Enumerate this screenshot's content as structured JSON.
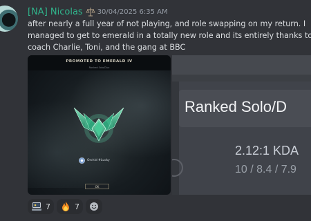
{
  "message": {
    "username": "[NA] Nicolas",
    "role_icon": "scales-icon",
    "timestamp": "30/04/2025 6:35 AM",
    "text_lines": [
      "after nearly a full year of not playing, and role swapping on my return. I",
      "managed to get to emerald in a totally new role and its entirely thanks to",
      "coach Charlie, Toni, and the gang at BBC"
    ]
  },
  "attachment1": {
    "banner_title": "PROMOTED TO EMERALD IV",
    "queue_label": "Ranked Solo/Duo",
    "player_name": "Orchid #Lucky",
    "ok_label": "OK"
  },
  "attachment2": {
    "title": "Ranked Solo/D",
    "kda": "2.12:1 KDA",
    "kda_detail": "10 / 8.4 / 7.9"
  },
  "reactions": [
    {
      "icon": "laptop-emoji-icon",
      "count": "7"
    },
    {
      "icon": "fire-emoji-icon",
      "count": "7"
    }
  ],
  "colors": {
    "background": "#313338",
    "username": "#30b58c",
    "text": "#dbdee1",
    "timestamp": "#949ba4",
    "emerald": "#3fbf8f"
  }
}
